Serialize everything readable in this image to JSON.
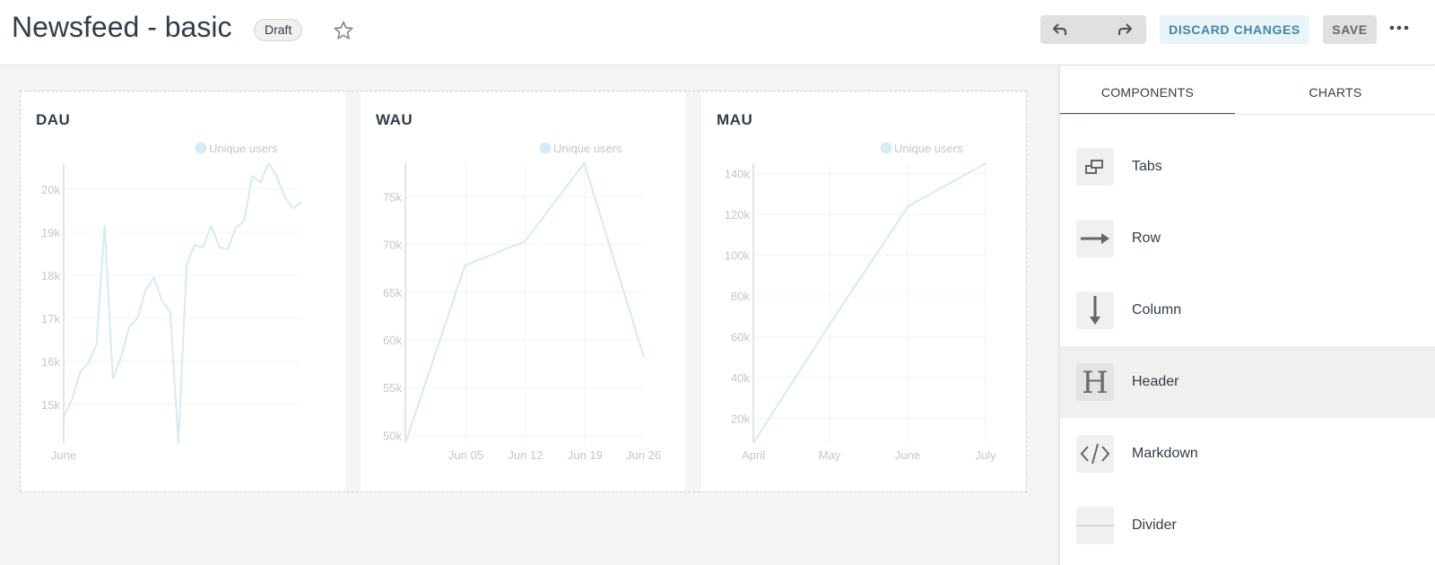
{
  "header": {
    "title": "Newsfeed - basic",
    "badge": "Draft",
    "discard_label": "DISCARD CHANGES",
    "save_label": "SAVE"
  },
  "colors": {
    "line": "#d6ebf2",
    "grid": "#f3f3f3",
    "axis": "#dcdcdc",
    "tick_text": "#c6c6c6",
    "discard_bg": "#e8f4f8",
    "discard_text": "#3f86a8",
    "tab_underline": "#484c6e"
  },
  "charts": [
    {
      "title": "DAU",
      "legend": "Unique users"
    },
    {
      "title": "WAU",
      "legend": "Unique users"
    },
    {
      "title": "MAU",
      "legend": "Unique users"
    }
  ],
  "chart_data": [
    {
      "type": "line",
      "title": "DAU",
      "legend": [
        "Unique users"
      ],
      "series": [
        {
          "name": "Unique users",
          "values": [
            14700,
            15100,
            15750,
            15950,
            16400,
            19150,
            15600,
            16100,
            16800,
            17000,
            17650,
            17950,
            17400,
            17150,
            14100,
            18250,
            18700,
            18650,
            19150,
            18650,
            18600,
            19100,
            19250,
            20300,
            20150,
            20600,
            20300,
            19800,
            19550,
            19700
          ]
        }
      ],
      "x_tick_labels": [
        "June"
      ],
      "y_ticks": [
        15000,
        16000,
        17000,
        18000,
        19000,
        20000
      ],
      "y_tick_labels": [
        "15k",
        "16k",
        "17k",
        "18k",
        "19k",
        "20k"
      ],
      "ylim": [
        14100,
        20600
      ],
      "grid": true
    },
    {
      "type": "line",
      "title": "WAU",
      "legend": [
        "Unique users"
      ],
      "x": [
        "Jun 05",
        "Jun 12",
        "Jun 19",
        "Jun 26"
      ],
      "series": [
        {
          "name": "Unique users",
          "values": [
            49200,
            67800,
            70300,
            78500,
            58200
          ]
        }
      ],
      "x_tick_labels": [
        "Jun 05",
        "Jun 12",
        "Jun 19",
        "Jun 26"
      ],
      "y_ticks": [
        50000,
        55000,
        60000,
        65000,
        70000,
        75000
      ],
      "y_tick_labels": [
        "50k",
        "55k",
        "60k",
        "65k",
        "70k",
        "75k"
      ],
      "ylim": [
        49200,
        78500
      ],
      "grid": true
    },
    {
      "type": "line",
      "title": "MAU",
      "legend": [
        "Unique users"
      ],
      "x": [
        "April",
        "May",
        "June",
        "July"
      ],
      "series": [
        {
          "name": "Unique users",
          "values": [
            8000,
            67000,
            124000,
            145000
          ]
        }
      ],
      "x_tick_labels": [
        "April",
        "May",
        "June",
        "July"
      ],
      "y_ticks": [
        20000,
        40000,
        60000,
        80000,
        100000,
        120000,
        140000
      ],
      "y_tick_labels": [
        "20k",
        "40k",
        "60k",
        "80k",
        "100k",
        "120k",
        "140k"
      ],
      "ylim": [
        8000,
        145000
      ],
      "grid": true
    }
  ],
  "sidebar": {
    "tabs": [
      {
        "label": "COMPONENTS",
        "active": true
      },
      {
        "label": "CHARTS",
        "active": false
      }
    ],
    "items": [
      {
        "label": "Tabs",
        "icon": "tabs-icon"
      },
      {
        "label": "Row",
        "icon": "arrow-right-icon"
      },
      {
        "label": "Column",
        "icon": "arrow-down-icon"
      },
      {
        "label": "Header",
        "icon": "header-icon"
      },
      {
        "label": "Markdown",
        "icon": "code-icon"
      },
      {
        "label": "Divider",
        "icon": "divider-icon"
      }
    ]
  }
}
